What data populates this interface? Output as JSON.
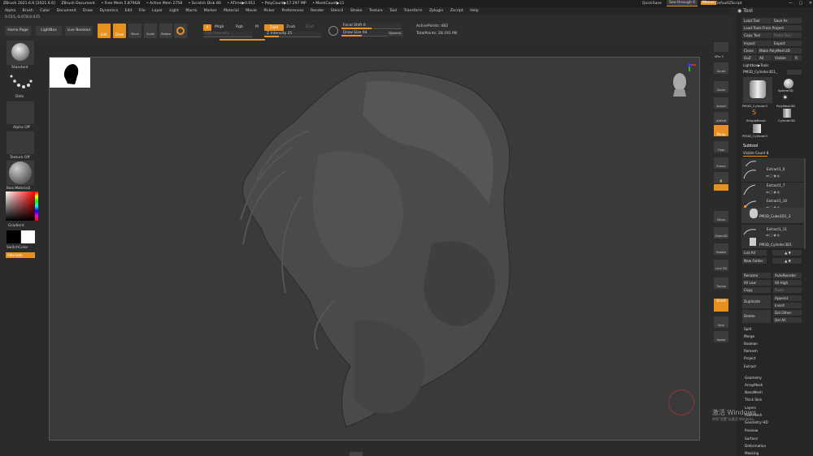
{
  "titlebar": {
    "items": [
      "ZBrush 2021.6.6 [2021.6.6]",
      "ZBrush Document",
      "• Free Mem 5.879GB",
      "• Active Mem 2758",
      "• Scratch Disk 80",
      "• ATime▶0.011",
      "• PolyCount▶17.297 MP",
      "• MeshCount▶11"
    ],
    "quicksave": "QuickSave",
    "see_through": "See-through 0",
    "menus_btn": "Menus",
    "default_script": "DefaultZScript"
  },
  "menubar": [
    "Alpha",
    "Brush",
    "Color",
    "Document",
    "Draw",
    "Dynamics",
    "Edit",
    "File",
    "Layer",
    "Light",
    "Macro",
    "Marker",
    "Material",
    "Movie",
    "Picker",
    "Preferences",
    "Render",
    "Stencil",
    "Stroke",
    "Texture",
    "Tool",
    "Transform",
    "Zplugin",
    "Zscript",
    "Help"
  ],
  "coords": "0.515,-0.078,0.035",
  "topshelf": {
    "home_page": "Home Page",
    "lightbox": "LightBox",
    "live_boolean": "Live Boolean",
    "edit": "Edit",
    "draw": "Draw",
    "move": "Move",
    "scale": "Scale",
    "rotate": "Rotate",
    "a_btn": "A",
    "mrgb": "Mrgb",
    "rgb": "Rgb",
    "m": "M",
    "zadd": "Zadd",
    "zsub": "Zsub",
    "zcut": "Zcut",
    "rgb_intensity": "Rgb Intensity",
    "z_intensity": "Z Intensity 25",
    "focal_shift": "Focal Shift 0",
    "draw_size": "Draw Size 64",
    "dynamic": "Dynamic",
    "active_points": "ActivePoints: 482",
    "total_points": "TotalPoints: 28.191 Mil"
  },
  "left": {
    "brush": "Standard",
    "stroke": "Dots",
    "alpha": "Alpha Off",
    "texture": "Texture Off",
    "material": "BasicMaterial2",
    "gradient": "Gradient",
    "switch_color": "SwitchColor",
    "alternate": "Alternate"
  },
  "rightshelf": [
    "SPix 3",
    "Scroll",
    "Zoom",
    "Actual",
    "AAHalf",
    "Persp",
    "Floor",
    "Frame",
    "Move",
    "Zoom3D",
    "Rotate",
    "Line Fill",
    "PolyF",
    "Transp",
    "Ghost",
    "Solo",
    "Xpose"
  ],
  "tool": {
    "title": "Tool",
    "load_tool": "Load Tool",
    "save_as": "Save As",
    "load_from_project": "Load Tools From Project",
    "copy_tool": "Copy Tool",
    "paste_tool": "Paste Tool",
    "import": "Import",
    "export": "Export",
    "clone": "Clone",
    "make_polymesh": "Make PolyMesh3D",
    "goz": "GoZ",
    "all": "All",
    "visible": "Visible",
    "r": "R",
    "lightbox_tools": "Lightbox▶Tools",
    "current_tool": "PM3D_Cylinder3D1_",
    "thumbs": [
      "PM3D_Cylinder3",
      "Sphere3D",
      "PolyMesh3D",
      "SimpleBrush",
      "Cylinder3D",
      "PM3D_Cylinder3"
    ],
    "subtool_title": "Subtool",
    "visible_count": "Visible Count 8",
    "subtools": [
      "",
      "Extract1_6",
      "Extract1_7",
      "Extract1_10",
      "PM3D_Cube3D1_3",
      "Extract1_11",
      "PM3D_Cylinder3D1"
    ],
    "list_all": "List All",
    "new_folder": "New Folder",
    "rename": "Rename",
    "autoreorder": "AutoReorder",
    "all_low": "All Low",
    "all_high": "All High",
    "copy": "Copy",
    "paste": "Paste",
    "duplicate": "Duplicate",
    "append": "Append",
    "insert": "Insert",
    "delete": "Delete",
    "del_other": "Del Other",
    "del_all": "Del All",
    "ops": [
      "Split",
      "Merge",
      "Boolean",
      "Remesh",
      "Project",
      "Extract"
    ],
    "sections": [
      "Geometry",
      "ArrayMesh",
      "NanoMesh",
      "Thick Skin",
      "Layers",
      "FiberMesh",
      "Geometry HD",
      "Preview",
      "Surface",
      "Deformation",
      "Masking"
    ]
  },
  "watermark": [
    "激活 Windows",
    "转到\"设置\"以激活 Windows。"
  ],
  "colors": {
    "accent": "#e8901e",
    "canvas": "#3a3a3a",
    "panel": "#2b2b2b"
  }
}
